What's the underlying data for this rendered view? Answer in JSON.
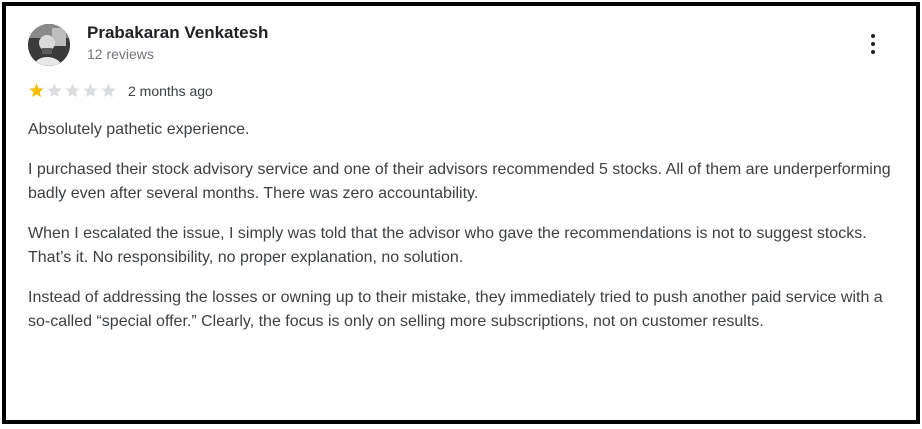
{
  "review": {
    "author_name": "Prabakaran Venkatesh",
    "review_count": "12 reviews",
    "rating": 1,
    "max_rating": 5,
    "date": "2 months ago",
    "paragraphs": [
      "Absolutely pathetic experience.",
      "I purchased their stock advisory service and one of their advisors recommended 5 stocks. All of them are underperforming badly even after several months. There was zero accountability.",
      "When I escalated the issue, I simply was told that the advisor who gave the recommendations is not to suggest stocks. That’s it. No responsibility, no proper explanation, no solution.",
      "Instead of addressing the losses or owning up to their mistake, they immediately tried to push another paid service with a so-called “special offer.” Clearly, the focus is only on selling more subscriptions, not on customer results."
    ]
  },
  "icons": {
    "avatar": "user-avatar-photo",
    "more": "more-vert-icon",
    "star": "star-icon"
  },
  "colors": {
    "star_filled": "#fbbc04",
    "star_empty": "#dadce0",
    "text": "#3c4043",
    "name": "#202124",
    "muted": "#70757a",
    "border": "#000000"
  }
}
